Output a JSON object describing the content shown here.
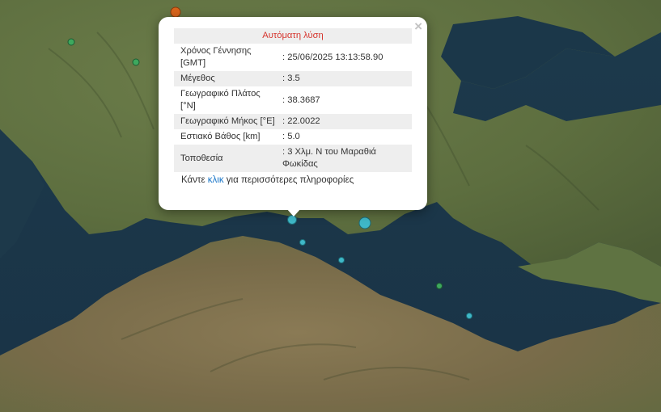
{
  "popup": {
    "title": "Αυτόματη λύση",
    "close_label": "×",
    "rows": [
      {
        "label": "Χρόνος Γέννησης [GMT]",
        "value": ": 25/06/2025 13:13:58.90"
      },
      {
        "label": "Μέγεθος",
        "value": ": 3.5"
      },
      {
        "label": "Γεωγραφικό Πλάτος [°N]",
        "value": ": 38.3687"
      },
      {
        "label": "Γεωγραφικό Μήκος [°E]",
        "value": ": 22.0022"
      },
      {
        "label": "Εστιακό Βάθος [km]",
        "value": ": 5.0"
      },
      {
        "label": "Τοποθεσία",
        "value": ": 3 Χλμ. N του Μαραθιά Φωκίδας"
      }
    ],
    "more_prefix": "Κάντε ",
    "more_link": "κλικ",
    "more_suffix": " για περισσότερες πληροφορίες"
  },
  "markers": [
    {
      "type": "orange-event",
      "color": "#d9651c"
    },
    {
      "type": "green-event",
      "color": "#3ea85e"
    },
    {
      "type": "green-event",
      "color": "#3ea85e"
    },
    {
      "type": "selected-event",
      "color": "#3fb8c8"
    },
    {
      "type": "cyan-event",
      "color": "#3fb8c8"
    },
    {
      "type": "cyan-event",
      "color": "#3fb8c8"
    },
    {
      "type": "cyan-event",
      "color": "#3fb8c8"
    },
    {
      "type": "green-event",
      "color": "#3ea85e"
    },
    {
      "type": "cyan-event",
      "color": "#3fb8c8"
    }
  ]
}
